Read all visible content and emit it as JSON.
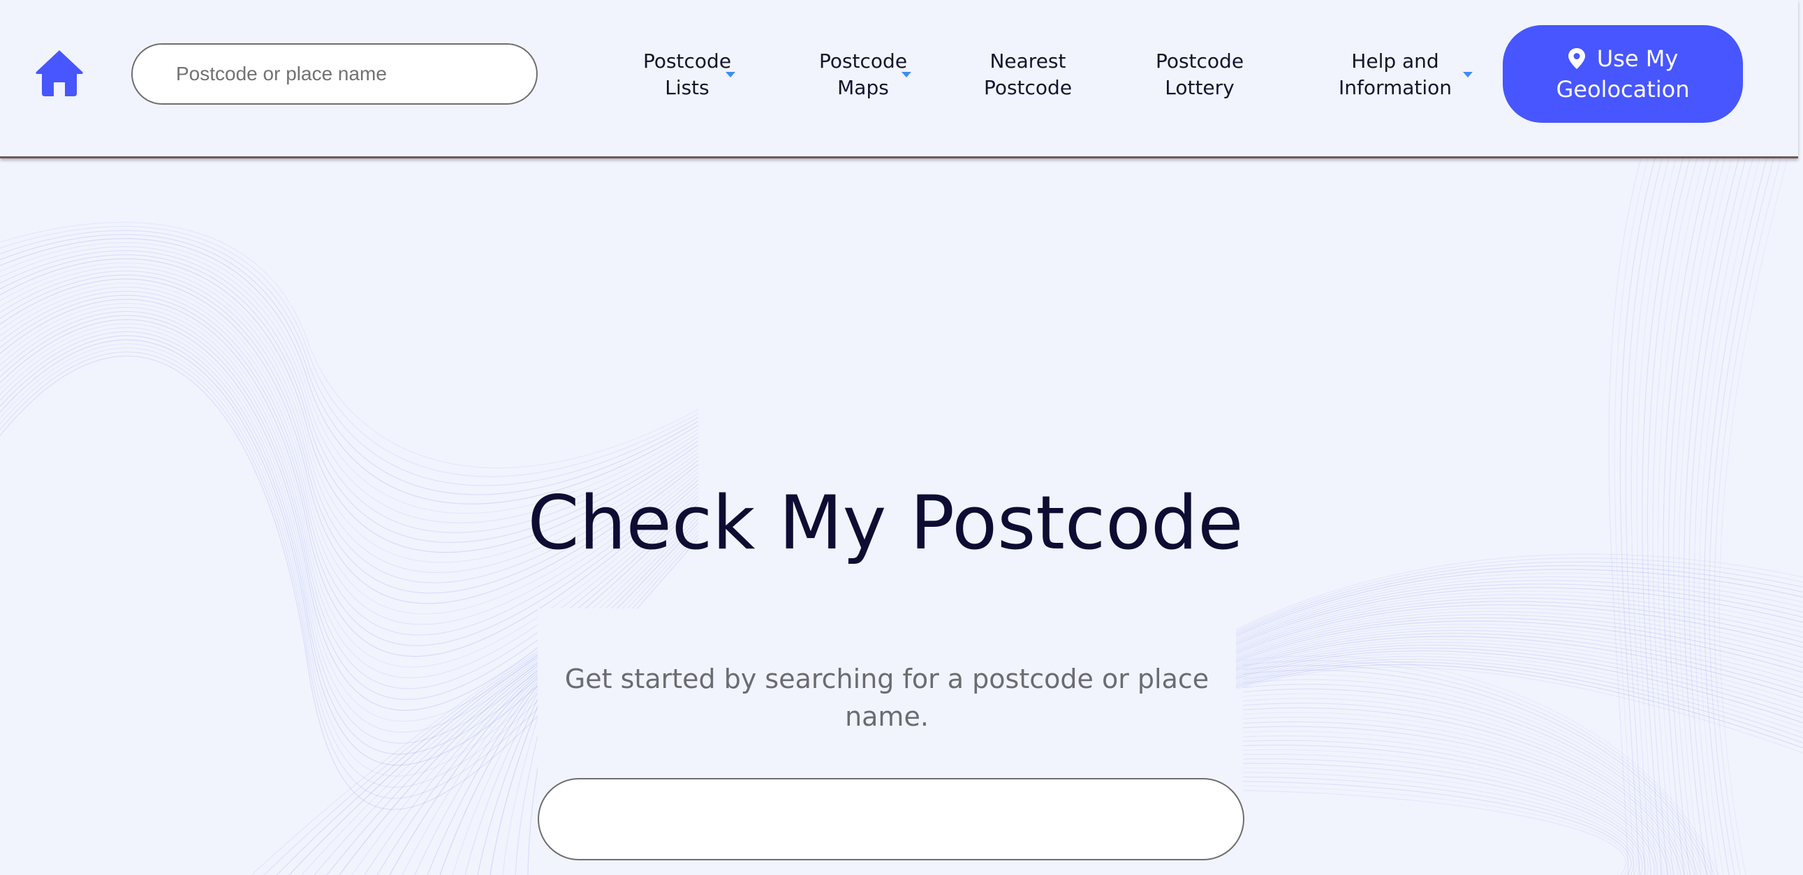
{
  "header": {
    "home_icon": "home-icon",
    "search": {
      "placeholder": "Postcode or place name",
      "value": ""
    },
    "nav": [
      {
        "label": "Postcode\nLists",
        "has_dropdown": true,
        "icon": "caret-down-icon"
      },
      {
        "label": "Postcode\nMaps",
        "has_dropdown": true,
        "icon": "caret-down-icon"
      },
      {
        "label": "Nearest\nPostcode",
        "has_dropdown": false
      },
      {
        "label": "Postcode\nLottery",
        "has_dropdown": false
      },
      {
        "label": "Help and\nInformation",
        "has_dropdown": true,
        "icon": "caret-down-icon"
      }
    ],
    "geolocation_button": {
      "line1": "Use My",
      "line2": "Geolocation",
      "icon": "map-pin-icon"
    }
  },
  "hero": {
    "title": "Check My Postcode",
    "subtitle": "Get started by searching for a postcode or place name.",
    "search": {
      "placeholder": "",
      "value": ""
    }
  },
  "colors": {
    "background": "#f1f4fd",
    "accent": "#4756ff",
    "caret": "#3f8cf6",
    "title": "#0d0d33",
    "subtitle": "#6b6b72",
    "wave": "#7a82f0"
  }
}
